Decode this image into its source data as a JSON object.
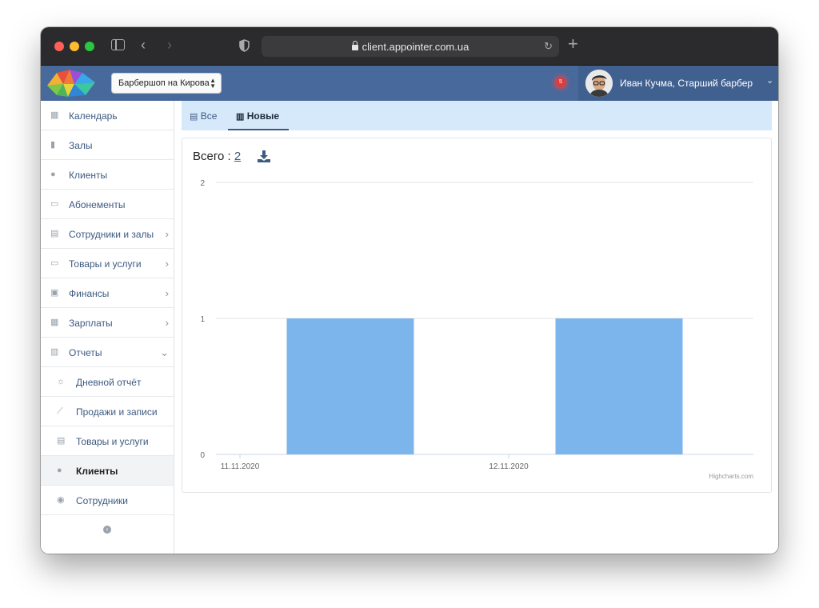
{
  "browser": {
    "url": "client.appointer.com.ua"
  },
  "header": {
    "branch_select": "Барбершоп на Кирова",
    "notification_count": "5",
    "user_name": "Иван Кучма, Старший барбер"
  },
  "sidebar": {
    "items": [
      {
        "label": "Календарь",
        "icon": "calendar-icon"
      },
      {
        "label": "Залы",
        "icon": "bookmark-icon"
      },
      {
        "label": "Клиенты",
        "icon": "users-icon"
      },
      {
        "label": "Абонементы",
        "icon": "card-icon"
      },
      {
        "label": "Сотрудники и залы",
        "icon": "id-card-icon"
      },
      {
        "label": "Товары и услуги",
        "icon": "card-icon"
      },
      {
        "label": "Финансы",
        "icon": "money-icon"
      },
      {
        "label": "Зарплаты",
        "icon": "calculator-icon"
      },
      {
        "label": "Отчеты",
        "icon": "bar-chart-icon"
      }
    ],
    "subitems": [
      {
        "label": "Дневной отчёт",
        "icon": "sun-icon"
      },
      {
        "label": "Продажи и записи",
        "icon": "line-chart-icon"
      },
      {
        "label": "Товары и услуги",
        "icon": "list-icon"
      },
      {
        "label": "Клиенты",
        "icon": "users-icon"
      },
      {
        "label": "Сотрудники",
        "icon": "user-circle-icon"
      }
    ]
  },
  "tabs": [
    {
      "label": "Все",
      "icon": "table-icon"
    },
    {
      "label": "Новые",
      "icon": "bar-chart-icon"
    }
  ],
  "summary": {
    "label": "Всего :",
    "value": "2"
  },
  "colors": {
    "header": "#48699b",
    "bar": "#7cb5ec",
    "tabs_bg": "#d6e9fb"
  },
  "chart_data": {
    "type": "bar",
    "categories": [
      "11.11.2020",
      "12.11.2020"
    ],
    "values": [
      1,
      1
    ],
    "ylim": [
      0,
      2
    ],
    "yticks": [
      0,
      1,
      2
    ],
    "credits": "Highcharts.com",
    "grid": true
  }
}
